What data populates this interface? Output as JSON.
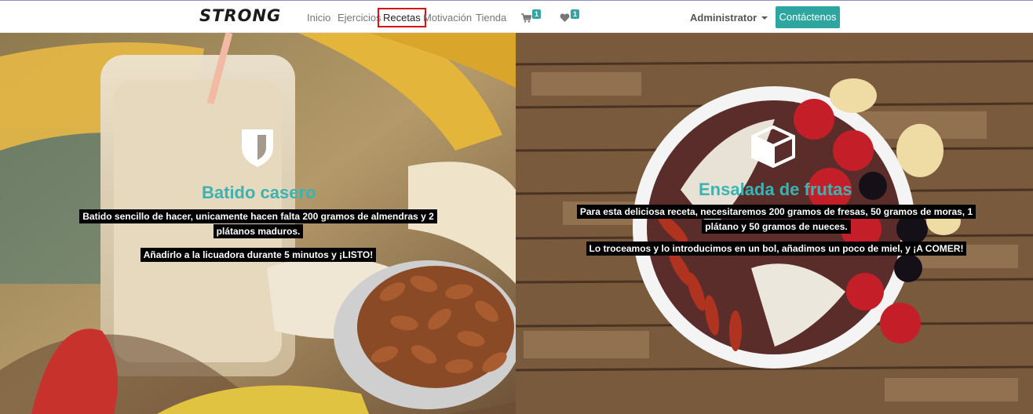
{
  "nav": {
    "logo": "STRONG",
    "links": [
      "Inicio",
      "Ejercicios",
      "Recetas",
      "Motivación",
      "Tienda"
    ],
    "cart_count": "1",
    "wishlist_count": "1",
    "user": "Administrator",
    "contact_label": "Contáctenos"
  },
  "recipes": [
    {
      "icon": "shield-icon",
      "title": "Batido casero",
      "p1": "Batido sencillo de hacer, unicamente hacen falta 200 gramos de almendras y 2 plátanos maduros.",
      "p2": "Añadirlo a la licuadora durante 5 minutos y ¡LISTO!"
    },
    {
      "icon": "cube-icon",
      "title": "Ensalada de frutas",
      "p1": "Para esta deliciosa receta, necesitaremos 200 gramos de fresas, 50 gramos de moras, 1 plátano y 50 gramos de nueces.",
      "p2": "Lo troceamos y lo introducimos en un bol, añadimos un poco de miel, y ¡A COMER!"
    }
  ],
  "colors": {
    "accent": "#2ea6a0",
    "title": "#3bb3b0",
    "active_outline": "#d51515"
  }
}
